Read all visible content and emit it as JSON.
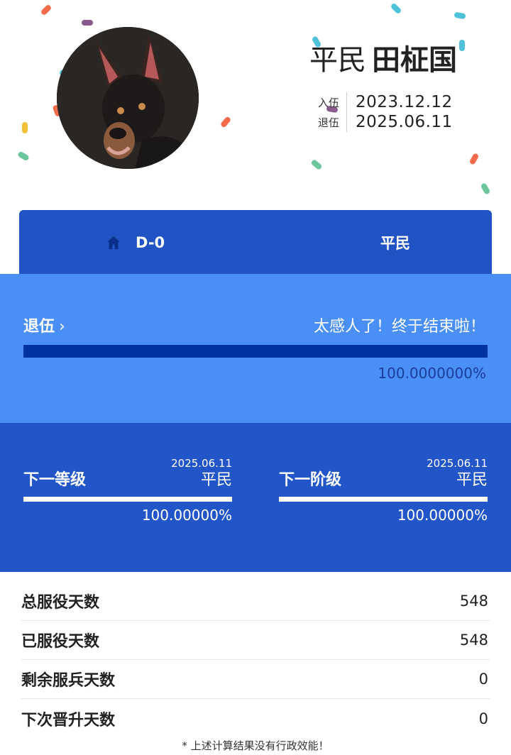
{
  "profile": {
    "rank": "平民",
    "name": "田柾国",
    "enlist_label": "入伍",
    "enlist_date": "2023.12.12",
    "discharge_label": "退伍",
    "discharge_date": "2025.06.11"
  },
  "tabs": [
    {
      "label": "D-0",
      "icon": "home-icon"
    },
    {
      "label": "平民"
    }
  ],
  "discharge": {
    "label": "退伍",
    "message": "太感人了！终于结束啦！",
    "progress": 100,
    "percent_text": "100.0000000%"
  },
  "next_level": {
    "title": "下一等级",
    "date": "2025.06.11",
    "rank": "平民",
    "progress": 100,
    "percent_text": "100.00000%"
  },
  "next_stage": {
    "title": "下一阶级",
    "date": "2025.06.11",
    "rank": "平民",
    "progress": 100,
    "percent_text": "100.00000%"
  },
  "stats": [
    {
      "label": "总服役天数",
      "value": "548"
    },
    {
      "label": "已服役天数",
      "value": "548"
    },
    {
      "label": "剩余服兵天数",
      "value": "0"
    },
    {
      "label": "下次晋升天数",
      "value": "0"
    }
  ],
  "footnote": "* 上述计算结果没有行政效能！",
  "colors": {
    "tab_bg": "#2253c4",
    "discharge_bg": "#4a8ff5",
    "discharge_fill": "#0032a0",
    "levels_bg": "#2256c8"
  }
}
